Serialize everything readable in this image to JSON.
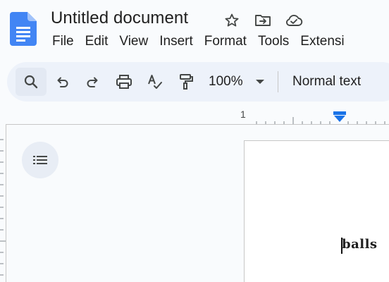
{
  "document": {
    "title": "Untitled document",
    "body_text": "balls"
  },
  "header": {
    "logo_icon": "google-docs-logo",
    "icons": [
      "star-icon",
      "move-to-folder-icon",
      "cloud-saved-icon"
    ]
  },
  "menu": {
    "items": [
      "File",
      "Edit",
      "View",
      "Insert",
      "Format",
      "Tools",
      "Extensi"
    ]
  },
  "toolbar": {
    "buttons": [
      "search-icon",
      "undo-icon",
      "redo-icon",
      "print-icon",
      "spellcheck-icon",
      "paint-format-icon"
    ],
    "zoom": "100%",
    "paragraph_style": "Normal text"
  },
  "ruler": {
    "label": "1"
  },
  "colors": {
    "accent": "#4285f4",
    "toolbar_bg": "#edf2fa",
    "page_bg": "#f9fbfd"
  }
}
